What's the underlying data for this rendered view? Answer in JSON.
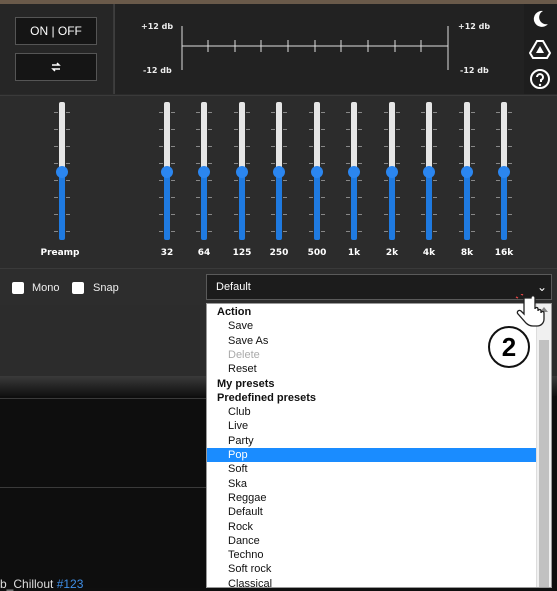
{
  "controls": {
    "onoff_label": "ON | OFF",
    "swap_icon": "swap-arrows-icon"
  },
  "graph": {
    "db_top_left": "+12 db",
    "db_bottom_left": "-12 db",
    "db_top_right": "+12 db",
    "db_bottom_right": "-12 db"
  },
  "icons": [
    "moon-icon",
    "google-drive-icon",
    "help-icon"
  ],
  "eq": {
    "preamp_label": "Preamp",
    "bands": [
      "32",
      "64",
      "125",
      "250",
      "500",
      "1k",
      "2k",
      "4k",
      "8k",
      "16k"
    ]
  },
  "options": {
    "mono_label": "Mono",
    "snap_label": "Snap"
  },
  "preset_select": {
    "value": "Default"
  },
  "dropdown": {
    "items": [
      {
        "label": "Action",
        "kind": "group"
      },
      {
        "label": "Save",
        "kind": "item"
      },
      {
        "label": "Save As",
        "kind": "item"
      },
      {
        "label": "Delete",
        "kind": "disabled"
      },
      {
        "label": "Reset",
        "kind": "item"
      },
      {
        "label": "My presets",
        "kind": "group"
      },
      {
        "label": "Predefined presets",
        "kind": "group"
      },
      {
        "label": "Club",
        "kind": "item"
      },
      {
        "label": "Live",
        "kind": "item"
      },
      {
        "label": "Party",
        "kind": "item"
      },
      {
        "label": "Pop",
        "kind": "selected"
      },
      {
        "label": "Soft",
        "kind": "item"
      },
      {
        "label": "Ska",
        "kind": "item"
      },
      {
        "label": "Reggae",
        "kind": "item"
      },
      {
        "label": "Default",
        "kind": "item"
      },
      {
        "label": "Rock",
        "kind": "item"
      },
      {
        "label": "Dance",
        "kind": "item"
      },
      {
        "label": "Techno",
        "kind": "item"
      },
      {
        "label": "Soft rock",
        "kind": "item"
      },
      {
        "label": "Classical",
        "kind": "item"
      }
    ]
  },
  "annotation": {
    "step": "2"
  },
  "background": {
    "prefix": "b_Chillout ",
    "tag": "#123"
  }
}
